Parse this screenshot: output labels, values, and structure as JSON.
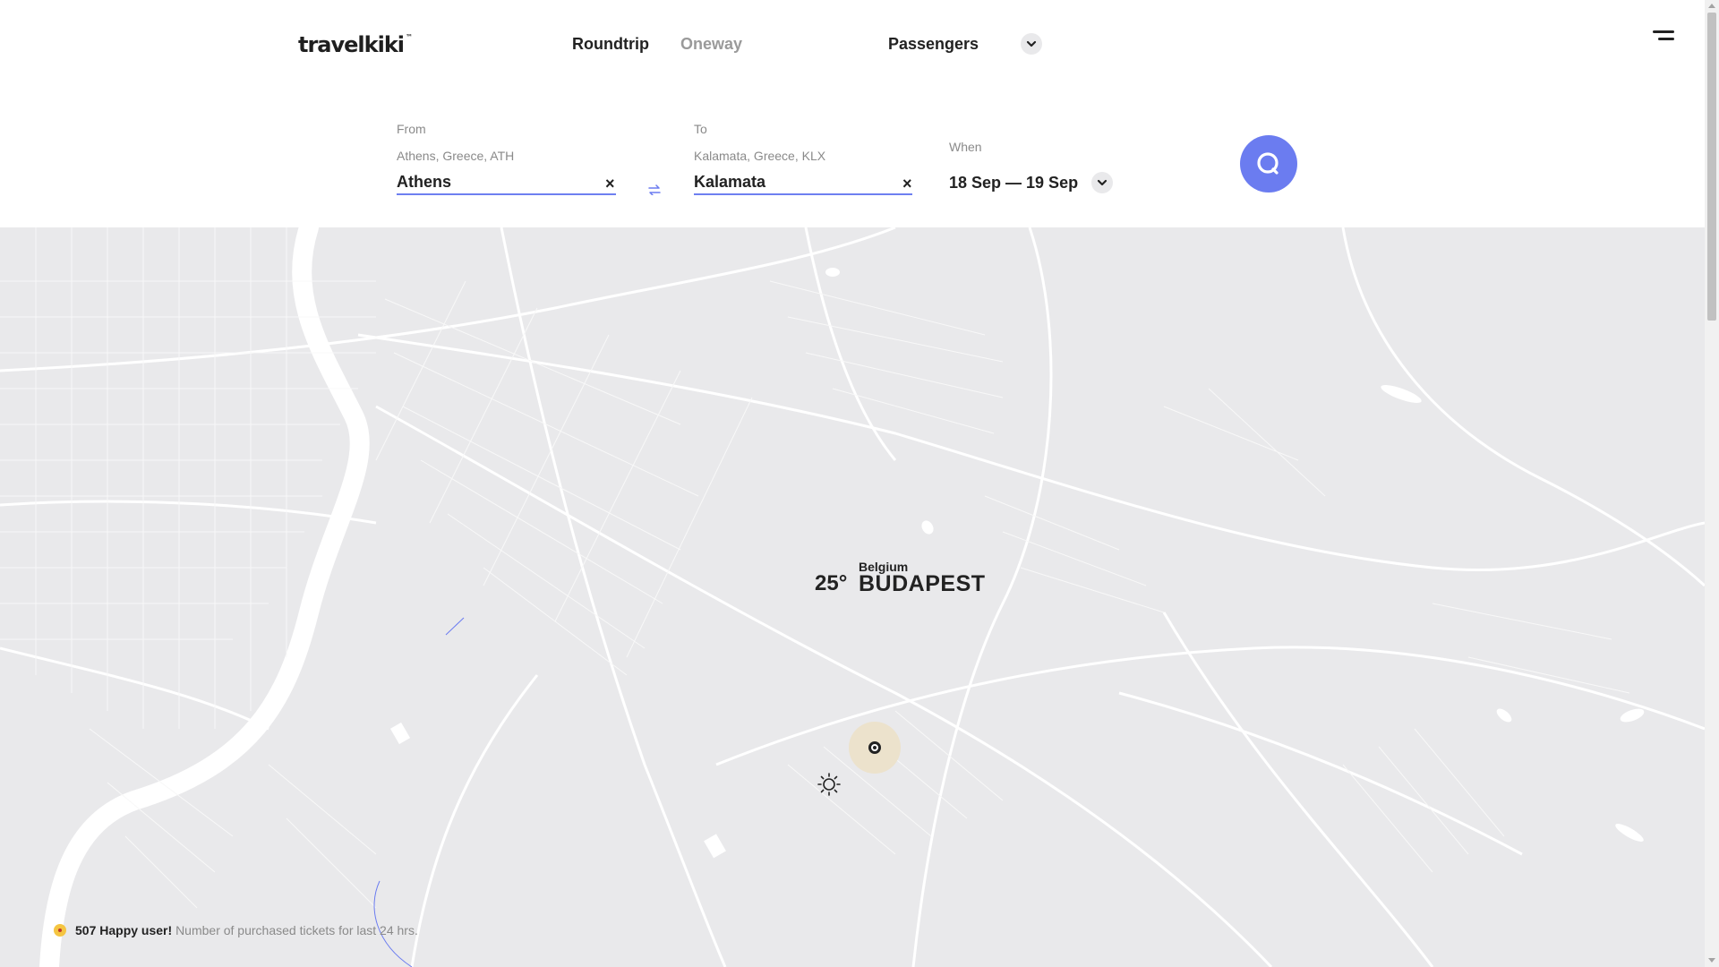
{
  "header": {
    "logo": "travelkiki",
    "logo_tm": "™",
    "tabs": [
      {
        "label": "Roundtrip",
        "active": true
      },
      {
        "label": "Oneway",
        "active": false
      }
    ],
    "passengers_label": "Passengers"
  },
  "search": {
    "from": {
      "label": "From",
      "sub": "Athens, Greece, ATH",
      "value": "Athens",
      "clear": "×"
    },
    "to": {
      "label": "To",
      "sub": "Kalamata, Greece, KLX",
      "value": "Kalamata",
      "clear": "×"
    },
    "when": {
      "label": "When",
      "value": "18 Sep — 19 Sep"
    },
    "search_icon": "search-icon"
  },
  "map": {
    "weather_icon": "sun-icon",
    "temperature": "25°",
    "country": "Belgium",
    "city": "BUDAPEST"
  },
  "footer": {
    "count_text": "507 Happy user!",
    "note_text": "Number of purchased tickets for last 24 hrs."
  },
  "colors": {
    "accent": "#6b7cf0",
    "map_bg": "#e9e9eb",
    "muted_text": "#8a8a8a",
    "pin_halo": "#ece2cc"
  }
}
